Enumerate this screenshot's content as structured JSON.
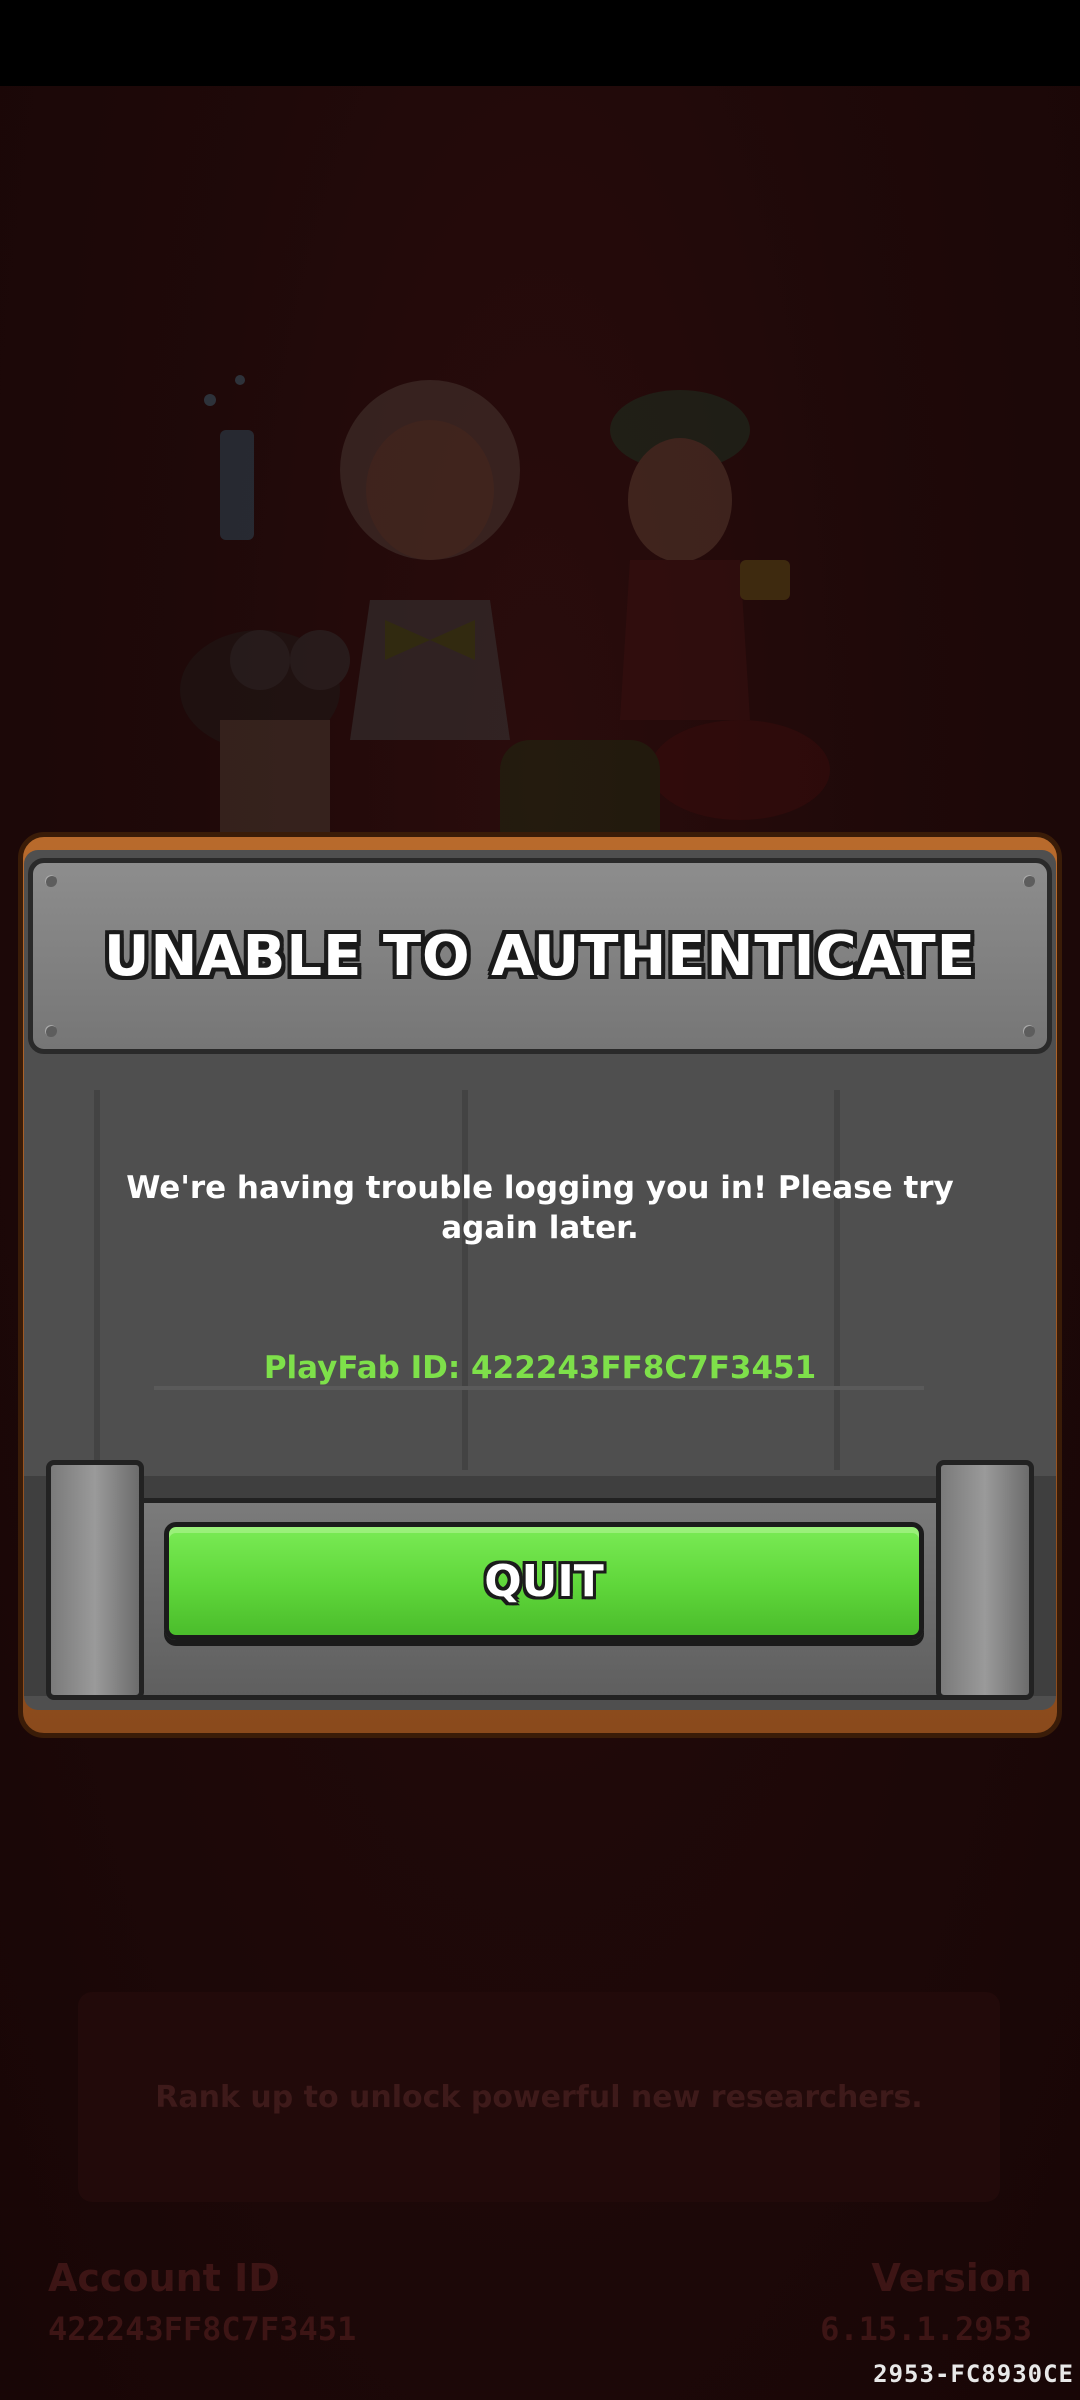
{
  "dialog": {
    "title": "UNABLE TO AUTHENTICATE",
    "message": "We're having trouble logging you in! Please try again later.",
    "playfab_id": "PlayFab ID: 422243FF8C7F3451",
    "quit_label": "QUIT"
  },
  "background": {
    "tip": "Rank up to unlock powerful new researchers.",
    "account_label": "Account ID",
    "account_value": "422243FF8C7F3451",
    "version_label": "Version",
    "version_value": "6.15.1.2953",
    "build_id": "2953-FC8930CE"
  },
  "colors": {
    "quit_button": "#5fd63a",
    "playfab_text": "#7ee04a",
    "background": "#1c0808"
  }
}
